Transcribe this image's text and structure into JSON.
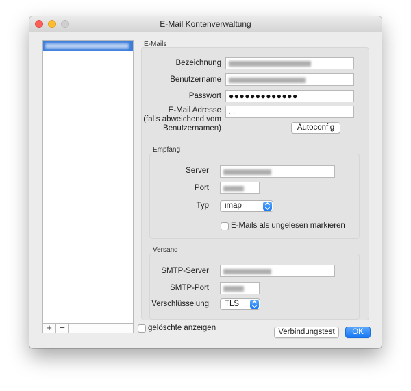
{
  "window": {
    "title": "E-Mail Kontenverwaltung"
  },
  "account_list": {
    "add_label": "+",
    "remove_label": "−"
  },
  "emails": {
    "section_label": "E-Mails",
    "fields": {
      "name_label": "Bezeichnung",
      "username_label": "Benutzername",
      "password_label": "Passwort",
      "password_value": "●●●●●●●●●●●●●",
      "email_label_line1": "E-Mail Adresse",
      "email_label_line2": "(falls abweichend vom",
      "email_label_line3": "Benutzernamen)",
      "email_placeholder": "..."
    },
    "autoconfig_label": "Autoconfig"
  },
  "incoming": {
    "section_label": "Empfang",
    "server_label": "Server",
    "port_label": "Port",
    "type_label": "Typ",
    "type_value": "imap",
    "mark_unread_label": "E-Mails als ungelesen markieren"
  },
  "outgoing": {
    "section_label": "Versand",
    "smtp_server_label": "SMTP-Server",
    "smtp_port_label": "SMTP-Port",
    "encryption_label": "Verschlüsselung",
    "encryption_value": "TLS"
  },
  "footer": {
    "show_deleted_label": "gelöschte anzeigen",
    "test_button_label": "Verbindungstest",
    "ok_button_label": "OK"
  },
  "colors": {
    "accent": "#1778f6",
    "selection": "#3a7ddb"
  }
}
